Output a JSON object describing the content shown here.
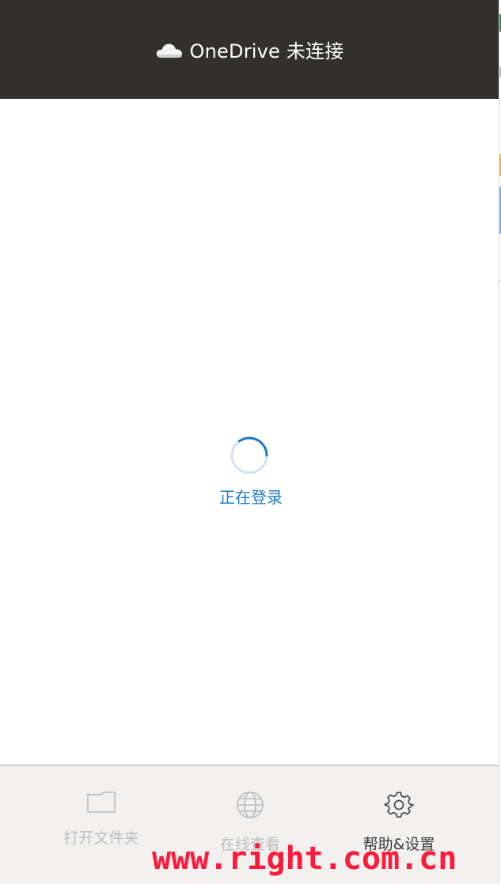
{
  "header": {
    "title": "OneDrive 未连接",
    "icon": "cloud-icon"
  },
  "main": {
    "status_text": "正在登录",
    "spinner_icon": "loading-spinner-icon"
  },
  "footer": {
    "items": [
      {
        "label": "打开文件夹",
        "icon": "folder-icon",
        "enabled": false
      },
      {
        "label": "在线查看",
        "icon": "globe-icon",
        "enabled": false
      },
      {
        "label": "帮助&设置",
        "icon": "gear-icon",
        "enabled": true
      }
    ]
  },
  "watermark": {
    "text": "www.right.com.cn"
  },
  "colors": {
    "header_bg": "#32302d",
    "accent": "#1b7ac2",
    "footer_bg": "#f2f1f0",
    "disabled_text": "#bdbdbd",
    "watermark": "#ff1a3c"
  }
}
